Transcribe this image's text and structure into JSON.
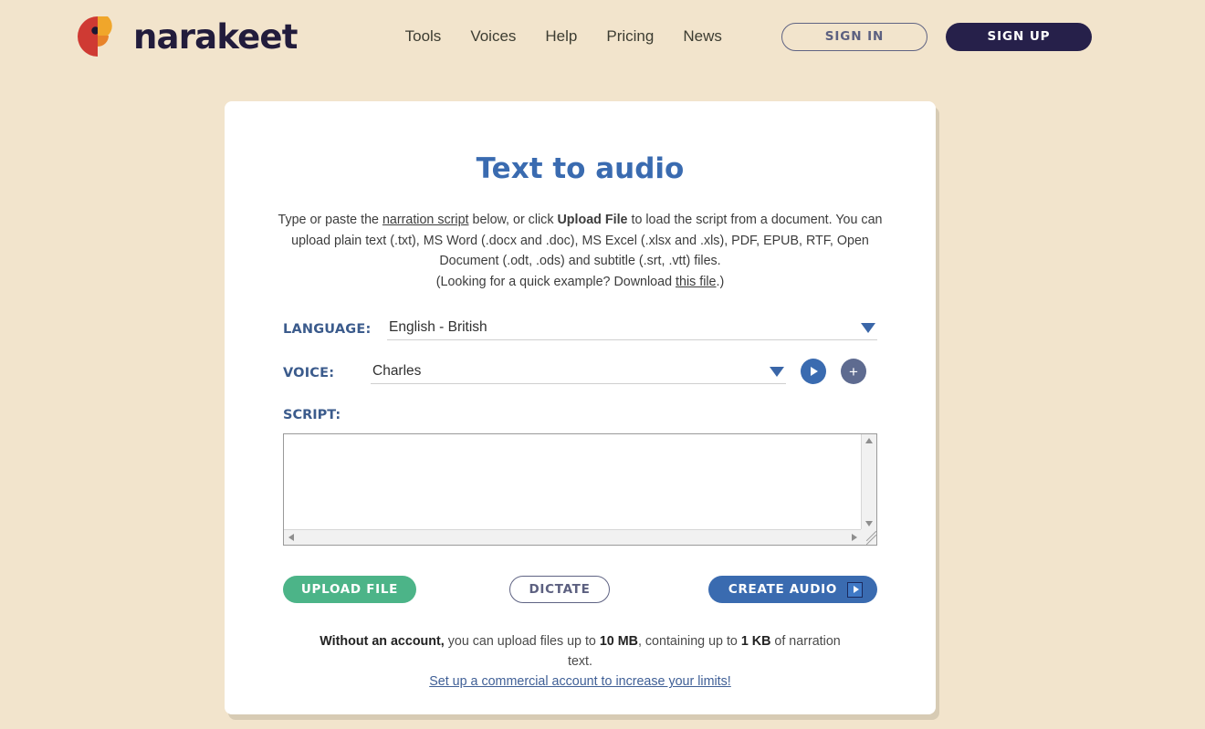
{
  "header": {
    "logo_text": "narakeet",
    "nav": [
      {
        "label": "Tools"
      },
      {
        "label": "Voices"
      },
      {
        "label": "Help"
      },
      {
        "label": "Pricing"
      },
      {
        "label": "News"
      }
    ],
    "sign_in": "SIGN IN",
    "sign_up": "SIGN UP"
  },
  "card": {
    "title": "Text to audio",
    "intro": {
      "p1_a": "Type or paste the ",
      "p1_link": "narration script",
      "p1_b": " below, or click ",
      "p1_bold": "Upload File",
      "p1_c": " to load the script from a document. You can upload plain text (.txt), MS Word (.docx and .doc), MS Excel (.xlsx and .xls), PDF, EPUB, RTF, Open Document (.odt, .ods) and subtitle (.srt, .vtt) files.",
      "p2_a": "(Looking for a quick example? Download ",
      "p2_link": "this file",
      "p2_b": ".)"
    },
    "language": {
      "label": "LANGUAGE:",
      "value": "English - British"
    },
    "voice": {
      "label": "VOICE:",
      "value": "Charles",
      "preview_icon": "play-icon",
      "add_icon": "plus-icon"
    },
    "script": {
      "label": "SCRIPT:",
      "value": "",
      "placeholder": ""
    },
    "buttons": {
      "upload": "UPLOAD FILE",
      "dictate": "DICTATE",
      "create": "CREATE AUDIO",
      "create_icon": "play-icon"
    },
    "note": {
      "bold1": "Without an account,",
      "text1": " you can upload files up to ",
      "bold2": "10 MB",
      "text2": ", containing up to ",
      "bold3": "1 KB",
      "text3": " of narration text.",
      "link": "Set up a commercial account to increase your limits!"
    }
  },
  "colors": {
    "page_bg": "#f2e4cc",
    "brand_navy": "#26204a",
    "title_blue": "#3a6bb0",
    "label_blue": "#3b5b8c",
    "upload_green": "#4cb488",
    "logo_red": "#cf3a33",
    "logo_orange": "#f0a62b"
  }
}
